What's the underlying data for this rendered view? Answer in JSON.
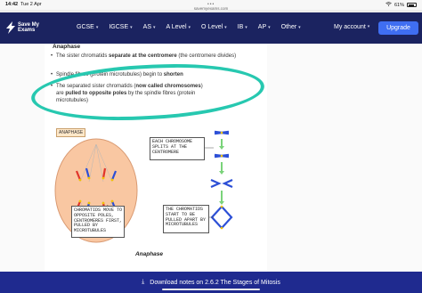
{
  "status": {
    "time": "14:42",
    "date": "Tue 2 Apr",
    "url": "savemyexams.com",
    "battery": "61%"
  },
  "nav": {
    "logo_line1": "Save My",
    "logo_line2": "Exams",
    "items": [
      {
        "label": "GCSE"
      },
      {
        "label": "IGCSE"
      },
      {
        "label": "AS"
      },
      {
        "label": "A Level"
      },
      {
        "label": "O Level"
      },
      {
        "label": "IB"
      },
      {
        "label": "AP"
      },
      {
        "label": "Other"
      }
    ],
    "account_label": "My account",
    "upgrade_label": "Upgrade"
  },
  "content": {
    "heading": "Anaphase",
    "bullet1_pre": "The sister chromatids ",
    "bullet1_bold": "separate at the centromere",
    "bullet1_post": " (the centromere divides)",
    "bullet2_pre": "Spindle fibres (protein microtubules) begin to ",
    "bullet2_bold": "shorten",
    "bullet3_pre": "The separated sister chromatids (",
    "bullet3_bold1": "now called chromosomes",
    "bullet3_mid": ") are ",
    "bullet3_bold2": "pulled to opposite poles",
    "bullet3_post": " by the spindle fibres (protein microtubules)"
  },
  "figure": {
    "tag": "ANAPHASE",
    "callout1": "EACH CHROMOSOME SPLITS AT THE CENTROMERE",
    "callout2": "CHROMATIDS MOVE TO OPPOSITE POLES, CENTROMERES FIRST, PULLED BY MICROTUBULES",
    "callout3": "THE CHROMATIDS START TO BE PULLED APART BY MICROTUBULES",
    "caption": "Anaphase"
  },
  "bottom": {
    "download_label": "Download notes on 2.6.2 The Stages of Mitosis"
  },
  "colors": {
    "navbar": "#1b2360",
    "upgrade": "#3f6ef2",
    "highlight_ring": "#27c8b0",
    "bottom_bar": "#1f2a8f"
  }
}
